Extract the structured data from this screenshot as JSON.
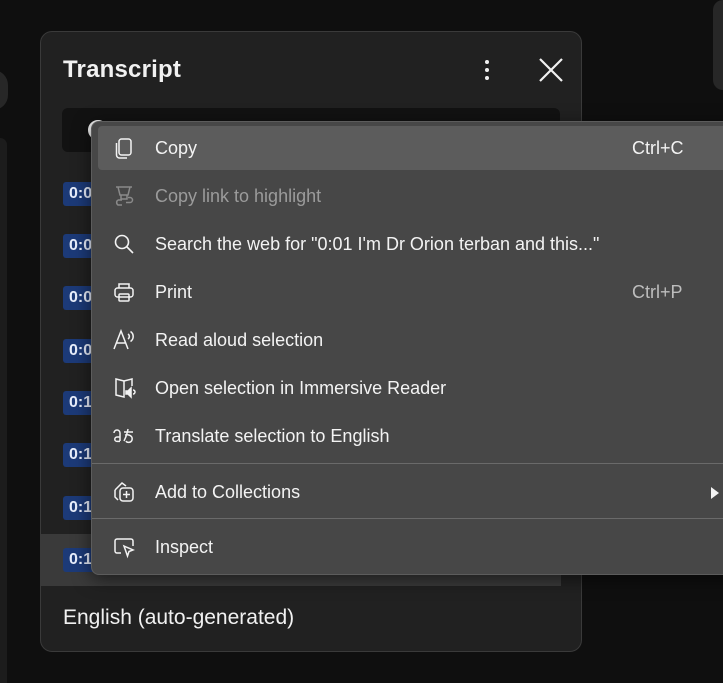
{
  "panel": {
    "title": "Transcript",
    "footer_language": "English (auto-generated)",
    "timestamps": [
      "0:0",
      "0:0",
      "0:0",
      "0:0",
      "0:1",
      "0:1",
      "0:1",
      "0:1"
    ]
  },
  "context_menu": {
    "items": [
      {
        "label": "Copy",
        "shortcut": "Ctrl+C",
        "icon": "copy-icon"
      },
      {
        "label": "Copy link to highlight",
        "icon": "link-highlight-icon"
      },
      {
        "label": "Search the web for \"0:01 I'm Dr Orion terban and this...\"",
        "icon": "search-icon"
      },
      {
        "label": "Print",
        "shortcut": "Ctrl+P",
        "icon": "printer-icon"
      },
      {
        "label": "Read aloud selection",
        "icon": "read-aloud-icon"
      },
      {
        "label": "Open selection in Immersive Reader",
        "icon": "immersive-reader-icon"
      },
      {
        "label": "Translate selection to English",
        "icon": "translate-icon"
      },
      {
        "label": "Add to Collections",
        "icon": "collections-icon"
      },
      {
        "label": "Inspect",
        "icon": "inspect-icon"
      }
    ]
  },
  "colors": {
    "panel_bg": "#212121",
    "menu_bg": "#474747",
    "timestamp_chip": "#1c3a78"
  }
}
